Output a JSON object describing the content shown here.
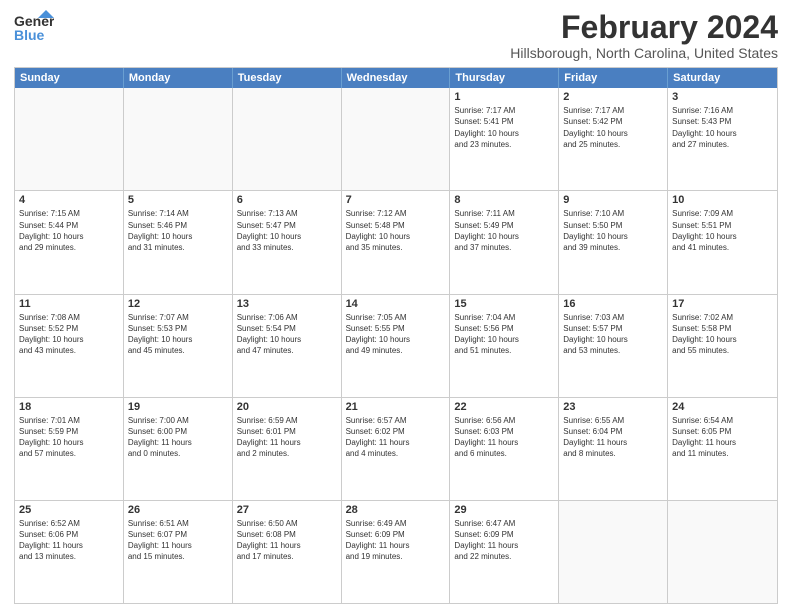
{
  "logo": {
    "line1": "General",
    "line2": "Blue"
  },
  "title": "February 2024",
  "location": "Hillsborough, North Carolina, United States",
  "weekdays": [
    "Sunday",
    "Monday",
    "Tuesday",
    "Wednesday",
    "Thursday",
    "Friday",
    "Saturday"
  ],
  "rows": [
    [
      {
        "day": "",
        "text": ""
      },
      {
        "day": "",
        "text": ""
      },
      {
        "day": "",
        "text": ""
      },
      {
        "day": "",
        "text": ""
      },
      {
        "day": "1",
        "text": "Sunrise: 7:17 AM\nSunset: 5:41 PM\nDaylight: 10 hours\nand 23 minutes."
      },
      {
        "day": "2",
        "text": "Sunrise: 7:17 AM\nSunset: 5:42 PM\nDaylight: 10 hours\nand 25 minutes."
      },
      {
        "day": "3",
        "text": "Sunrise: 7:16 AM\nSunset: 5:43 PM\nDaylight: 10 hours\nand 27 minutes."
      }
    ],
    [
      {
        "day": "4",
        "text": "Sunrise: 7:15 AM\nSunset: 5:44 PM\nDaylight: 10 hours\nand 29 minutes."
      },
      {
        "day": "5",
        "text": "Sunrise: 7:14 AM\nSunset: 5:46 PM\nDaylight: 10 hours\nand 31 minutes."
      },
      {
        "day": "6",
        "text": "Sunrise: 7:13 AM\nSunset: 5:47 PM\nDaylight: 10 hours\nand 33 minutes."
      },
      {
        "day": "7",
        "text": "Sunrise: 7:12 AM\nSunset: 5:48 PM\nDaylight: 10 hours\nand 35 minutes."
      },
      {
        "day": "8",
        "text": "Sunrise: 7:11 AM\nSunset: 5:49 PM\nDaylight: 10 hours\nand 37 minutes."
      },
      {
        "day": "9",
        "text": "Sunrise: 7:10 AM\nSunset: 5:50 PM\nDaylight: 10 hours\nand 39 minutes."
      },
      {
        "day": "10",
        "text": "Sunrise: 7:09 AM\nSunset: 5:51 PM\nDaylight: 10 hours\nand 41 minutes."
      }
    ],
    [
      {
        "day": "11",
        "text": "Sunrise: 7:08 AM\nSunset: 5:52 PM\nDaylight: 10 hours\nand 43 minutes."
      },
      {
        "day": "12",
        "text": "Sunrise: 7:07 AM\nSunset: 5:53 PM\nDaylight: 10 hours\nand 45 minutes."
      },
      {
        "day": "13",
        "text": "Sunrise: 7:06 AM\nSunset: 5:54 PM\nDaylight: 10 hours\nand 47 minutes."
      },
      {
        "day": "14",
        "text": "Sunrise: 7:05 AM\nSunset: 5:55 PM\nDaylight: 10 hours\nand 49 minutes."
      },
      {
        "day": "15",
        "text": "Sunrise: 7:04 AM\nSunset: 5:56 PM\nDaylight: 10 hours\nand 51 minutes."
      },
      {
        "day": "16",
        "text": "Sunrise: 7:03 AM\nSunset: 5:57 PM\nDaylight: 10 hours\nand 53 minutes."
      },
      {
        "day": "17",
        "text": "Sunrise: 7:02 AM\nSunset: 5:58 PM\nDaylight: 10 hours\nand 55 minutes."
      }
    ],
    [
      {
        "day": "18",
        "text": "Sunrise: 7:01 AM\nSunset: 5:59 PM\nDaylight: 10 hours\nand 57 minutes."
      },
      {
        "day": "19",
        "text": "Sunrise: 7:00 AM\nSunset: 6:00 PM\nDaylight: 11 hours\nand 0 minutes."
      },
      {
        "day": "20",
        "text": "Sunrise: 6:59 AM\nSunset: 6:01 PM\nDaylight: 11 hours\nand 2 minutes."
      },
      {
        "day": "21",
        "text": "Sunrise: 6:57 AM\nSunset: 6:02 PM\nDaylight: 11 hours\nand 4 minutes."
      },
      {
        "day": "22",
        "text": "Sunrise: 6:56 AM\nSunset: 6:03 PM\nDaylight: 11 hours\nand 6 minutes."
      },
      {
        "day": "23",
        "text": "Sunrise: 6:55 AM\nSunset: 6:04 PM\nDaylight: 11 hours\nand 8 minutes."
      },
      {
        "day": "24",
        "text": "Sunrise: 6:54 AM\nSunset: 6:05 PM\nDaylight: 11 hours\nand 11 minutes."
      }
    ],
    [
      {
        "day": "25",
        "text": "Sunrise: 6:52 AM\nSunset: 6:06 PM\nDaylight: 11 hours\nand 13 minutes."
      },
      {
        "day": "26",
        "text": "Sunrise: 6:51 AM\nSunset: 6:07 PM\nDaylight: 11 hours\nand 15 minutes."
      },
      {
        "day": "27",
        "text": "Sunrise: 6:50 AM\nSunset: 6:08 PM\nDaylight: 11 hours\nand 17 minutes."
      },
      {
        "day": "28",
        "text": "Sunrise: 6:49 AM\nSunset: 6:09 PM\nDaylight: 11 hours\nand 19 minutes."
      },
      {
        "day": "29",
        "text": "Sunrise: 6:47 AM\nSunset: 6:09 PM\nDaylight: 11 hours\nand 22 minutes."
      },
      {
        "day": "",
        "text": ""
      },
      {
        "day": "",
        "text": ""
      }
    ]
  ]
}
